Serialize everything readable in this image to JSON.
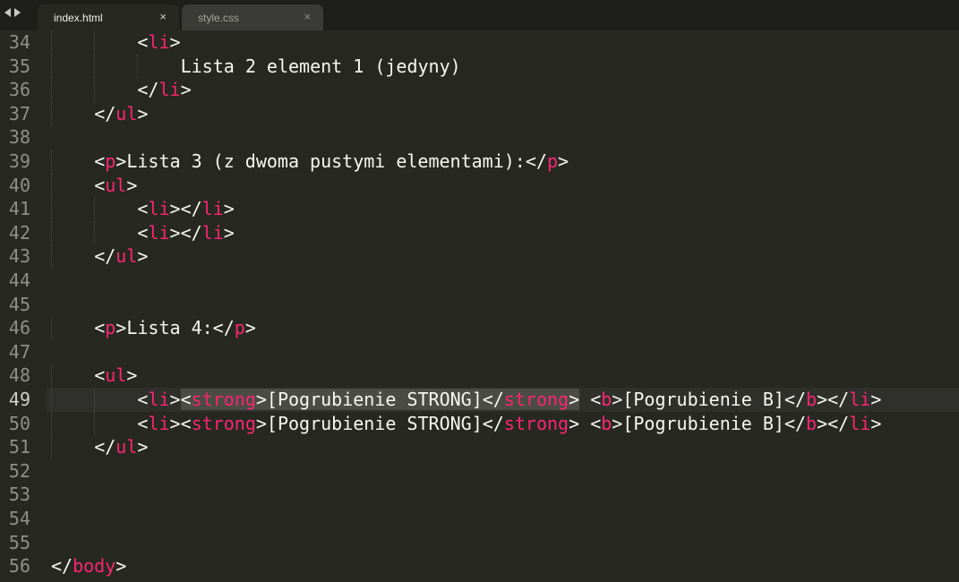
{
  "tabs": [
    {
      "label": "index.html",
      "close": "×",
      "active": true
    },
    {
      "label": "style.css",
      "close": "×",
      "active": false
    }
  ],
  "editor": {
    "active_line": 49,
    "lines": [
      {
        "num": "34",
        "indent": 8,
        "tokens": [
          {
            "t": "p",
            "v": "<"
          },
          {
            "t": "tag",
            "v": "li"
          },
          {
            "t": "p",
            "v": ">"
          }
        ]
      },
      {
        "num": "35",
        "indent": 12,
        "tokens": [
          {
            "t": "text",
            "v": "Lista 2 element 1 (jedyny)"
          }
        ]
      },
      {
        "num": "36",
        "indent": 8,
        "tokens": [
          {
            "t": "p",
            "v": "</"
          },
          {
            "t": "tag",
            "v": "li"
          },
          {
            "t": "p",
            "v": ">"
          }
        ]
      },
      {
        "num": "37",
        "indent": 4,
        "tokens": [
          {
            "t": "p",
            "v": "</"
          },
          {
            "t": "tag",
            "v": "ul"
          },
          {
            "t": "p",
            "v": ">"
          }
        ]
      },
      {
        "num": "38",
        "indent": 0,
        "tokens": []
      },
      {
        "num": "39",
        "indent": 4,
        "tokens": [
          {
            "t": "p",
            "v": "<"
          },
          {
            "t": "tag",
            "v": "p"
          },
          {
            "t": "p",
            "v": ">"
          },
          {
            "t": "text",
            "v": "Lista 3 (z dwoma pustymi elementami):"
          },
          {
            "t": "p",
            "v": "</"
          },
          {
            "t": "tag",
            "v": "p"
          },
          {
            "t": "p",
            "v": ">"
          }
        ]
      },
      {
        "num": "40",
        "indent": 4,
        "tokens": [
          {
            "t": "p",
            "v": "<"
          },
          {
            "t": "tag",
            "v": "ul"
          },
          {
            "t": "p",
            "v": ">"
          }
        ]
      },
      {
        "num": "41",
        "indent": 8,
        "tokens": [
          {
            "t": "p",
            "v": "<"
          },
          {
            "t": "tag",
            "v": "li"
          },
          {
            "t": "p",
            "v": "></"
          },
          {
            "t": "tag",
            "v": "li"
          },
          {
            "t": "p",
            "v": ">"
          }
        ]
      },
      {
        "num": "42",
        "indent": 8,
        "tokens": [
          {
            "t": "p",
            "v": "<"
          },
          {
            "t": "tag",
            "v": "li"
          },
          {
            "t": "p",
            "v": "></"
          },
          {
            "t": "tag",
            "v": "li"
          },
          {
            "t": "p",
            "v": ">"
          }
        ]
      },
      {
        "num": "43",
        "indent": 4,
        "tokens": [
          {
            "t": "p",
            "v": "</"
          },
          {
            "t": "tag",
            "v": "ul"
          },
          {
            "t": "p",
            "v": ">"
          }
        ]
      },
      {
        "num": "44",
        "indent": 0,
        "tokens": []
      },
      {
        "num": "45",
        "indent": 0,
        "tokens": []
      },
      {
        "num": "46",
        "indent": 4,
        "tokens": [
          {
            "t": "p",
            "v": "<"
          },
          {
            "t": "tag",
            "v": "p"
          },
          {
            "t": "p",
            "v": ">"
          },
          {
            "t": "text",
            "v": "Lista 4:"
          },
          {
            "t": "p",
            "v": "</"
          },
          {
            "t": "tag",
            "v": "p"
          },
          {
            "t": "p",
            "v": ">"
          }
        ]
      },
      {
        "num": "47",
        "indent": 0,
        "tokens": []
      },
      {
        "num": "48",
        "indent": 4,
        "tokens": [
          {
            "t": "p",
            "v": "<"
          },
          {
            "t": "tag",
            "v": "ul"
          },
          {
            "t": "p",
            "v": ">"
          }
        ]
      },
      {
        "num": "49",
        "indent": 8,
        "tokens": [
          {
            "t": "p",
            "v": "<"
          },
          {
            "t": "tag",
            "v": "li"
          },
          {
            "t": "p",
            "v": ">"
          },
          {
            "t": "p",
            "v": "<",
            "hl": true
          },
          {
            "t": "tag",
            "v": "strong",
            "hl": true
          },
          {
            "t": "p",
            "v": ">",
            "hl": true
          },
          {
            "t": "text",
            "v": "[Pogrubienie STRONG]",
            "hl": true
          },
          {
            "t": "p",
            "v": "</",
            "hl": true
          },
          {
            "t": "tag",
            "v": "strong",
            "hl": true
          },
          {
            "t": "p",
            "v": ">",
            "hl": true
          },
          {
            "t": "text",
            "v": " "
          },
          {
            "t": "p",
            "v": "<"
          },
          {
            "t": "tag",
            "v": "b"
          },
          {
            "t": "p",
            "v": ">"
          },
          {
            "t": "text",
            "v": "[Pogrubienie B]"
          },
          {
            "t": "p",
            "v": "</"
          },
          {
            "t": "tag",
            "v": "b"
          },
          {
            "t": "p",
            "v": "></"
          },
          {
            "t": "tag",
            "v": "li"
          },
          {
            "t": "p",
            "v": ">"
          }
        ]
      },
      {
        "num": "50",
        "indent": 8,
        "tokens": [
          {
            "t": "p",
            "v": "<"
          },
          {
            "t": "tag",
            "v": "li"
          },
          {
            "t": "p",
            "v": "><"
          },
          {
            "t": "tag",
            "v": "strong"
          },
          {
            "t": "p",
            "v": ">"
          },
          {
            "t": "text",
            "v": "[Pogrubienie STRONG]"
          },
          {
            "t": "p",
            "v": "</"
          },
          {
            "t": "tag",
            "v": "strong"
          },
          {
            "t": "p",
            "v": ">"
          },
          {
            "t": "text",
            "v": " "
          },
          {
            "t": "p",
            "v": "<"
          },
          {
            "t": "tag",
            "v": "b"
          },
          {
            "t": "p",
            "v": ">"
          },
          {
            "t": "text",
            "v": "[Pogrubienie B]"
          },
          {
            "t": "p",
            "v": "</"
          },
          {
            "t": "tag",
            "v": "b"
          },
          {
            "t": "p",
            "v": "></"
          },
          {
            "t": "tag",
            "v": "li"
          },
          {
            "t": "p",
            "v": ">"
          }
        ]
      },
      {
        "num": "51",
        "indent": 4,
        "tokens": [
          {
            "t": "p",
            "v": "</"
          },
          {
            "t": "tag",
            "v": "ul"
          },
          {
            "t": "p",
            "v": ">"
          }
        ]
      },
      {
        "num": "52",
        "indent": 0,
        "tokens": []
      },
      {
        "num": "53",
        "indent": 0,
        "tokens": []
      },
      {
        "num": "54",
        "indent": 0,
        "tokens": []
      },
      {
        "num": "55",
        "indent": 0,
        "tokens": []
      },
      {
        "num": "56",
        "indent": 0,
        "tokens": [
          {
            "t": "p",
            "v": "</"
          },
          {
            "t": "tag",
            "v": "body"
          },
          {
            "t": "p",
            "v": ">"
          }
        ]
      }
    ]
  },
  "colors": {
    "background": "#272822",
    "tag": "#f92672",
    "text": "#f8f8f2",
    "gutter": "#8f908a"
  }
}
